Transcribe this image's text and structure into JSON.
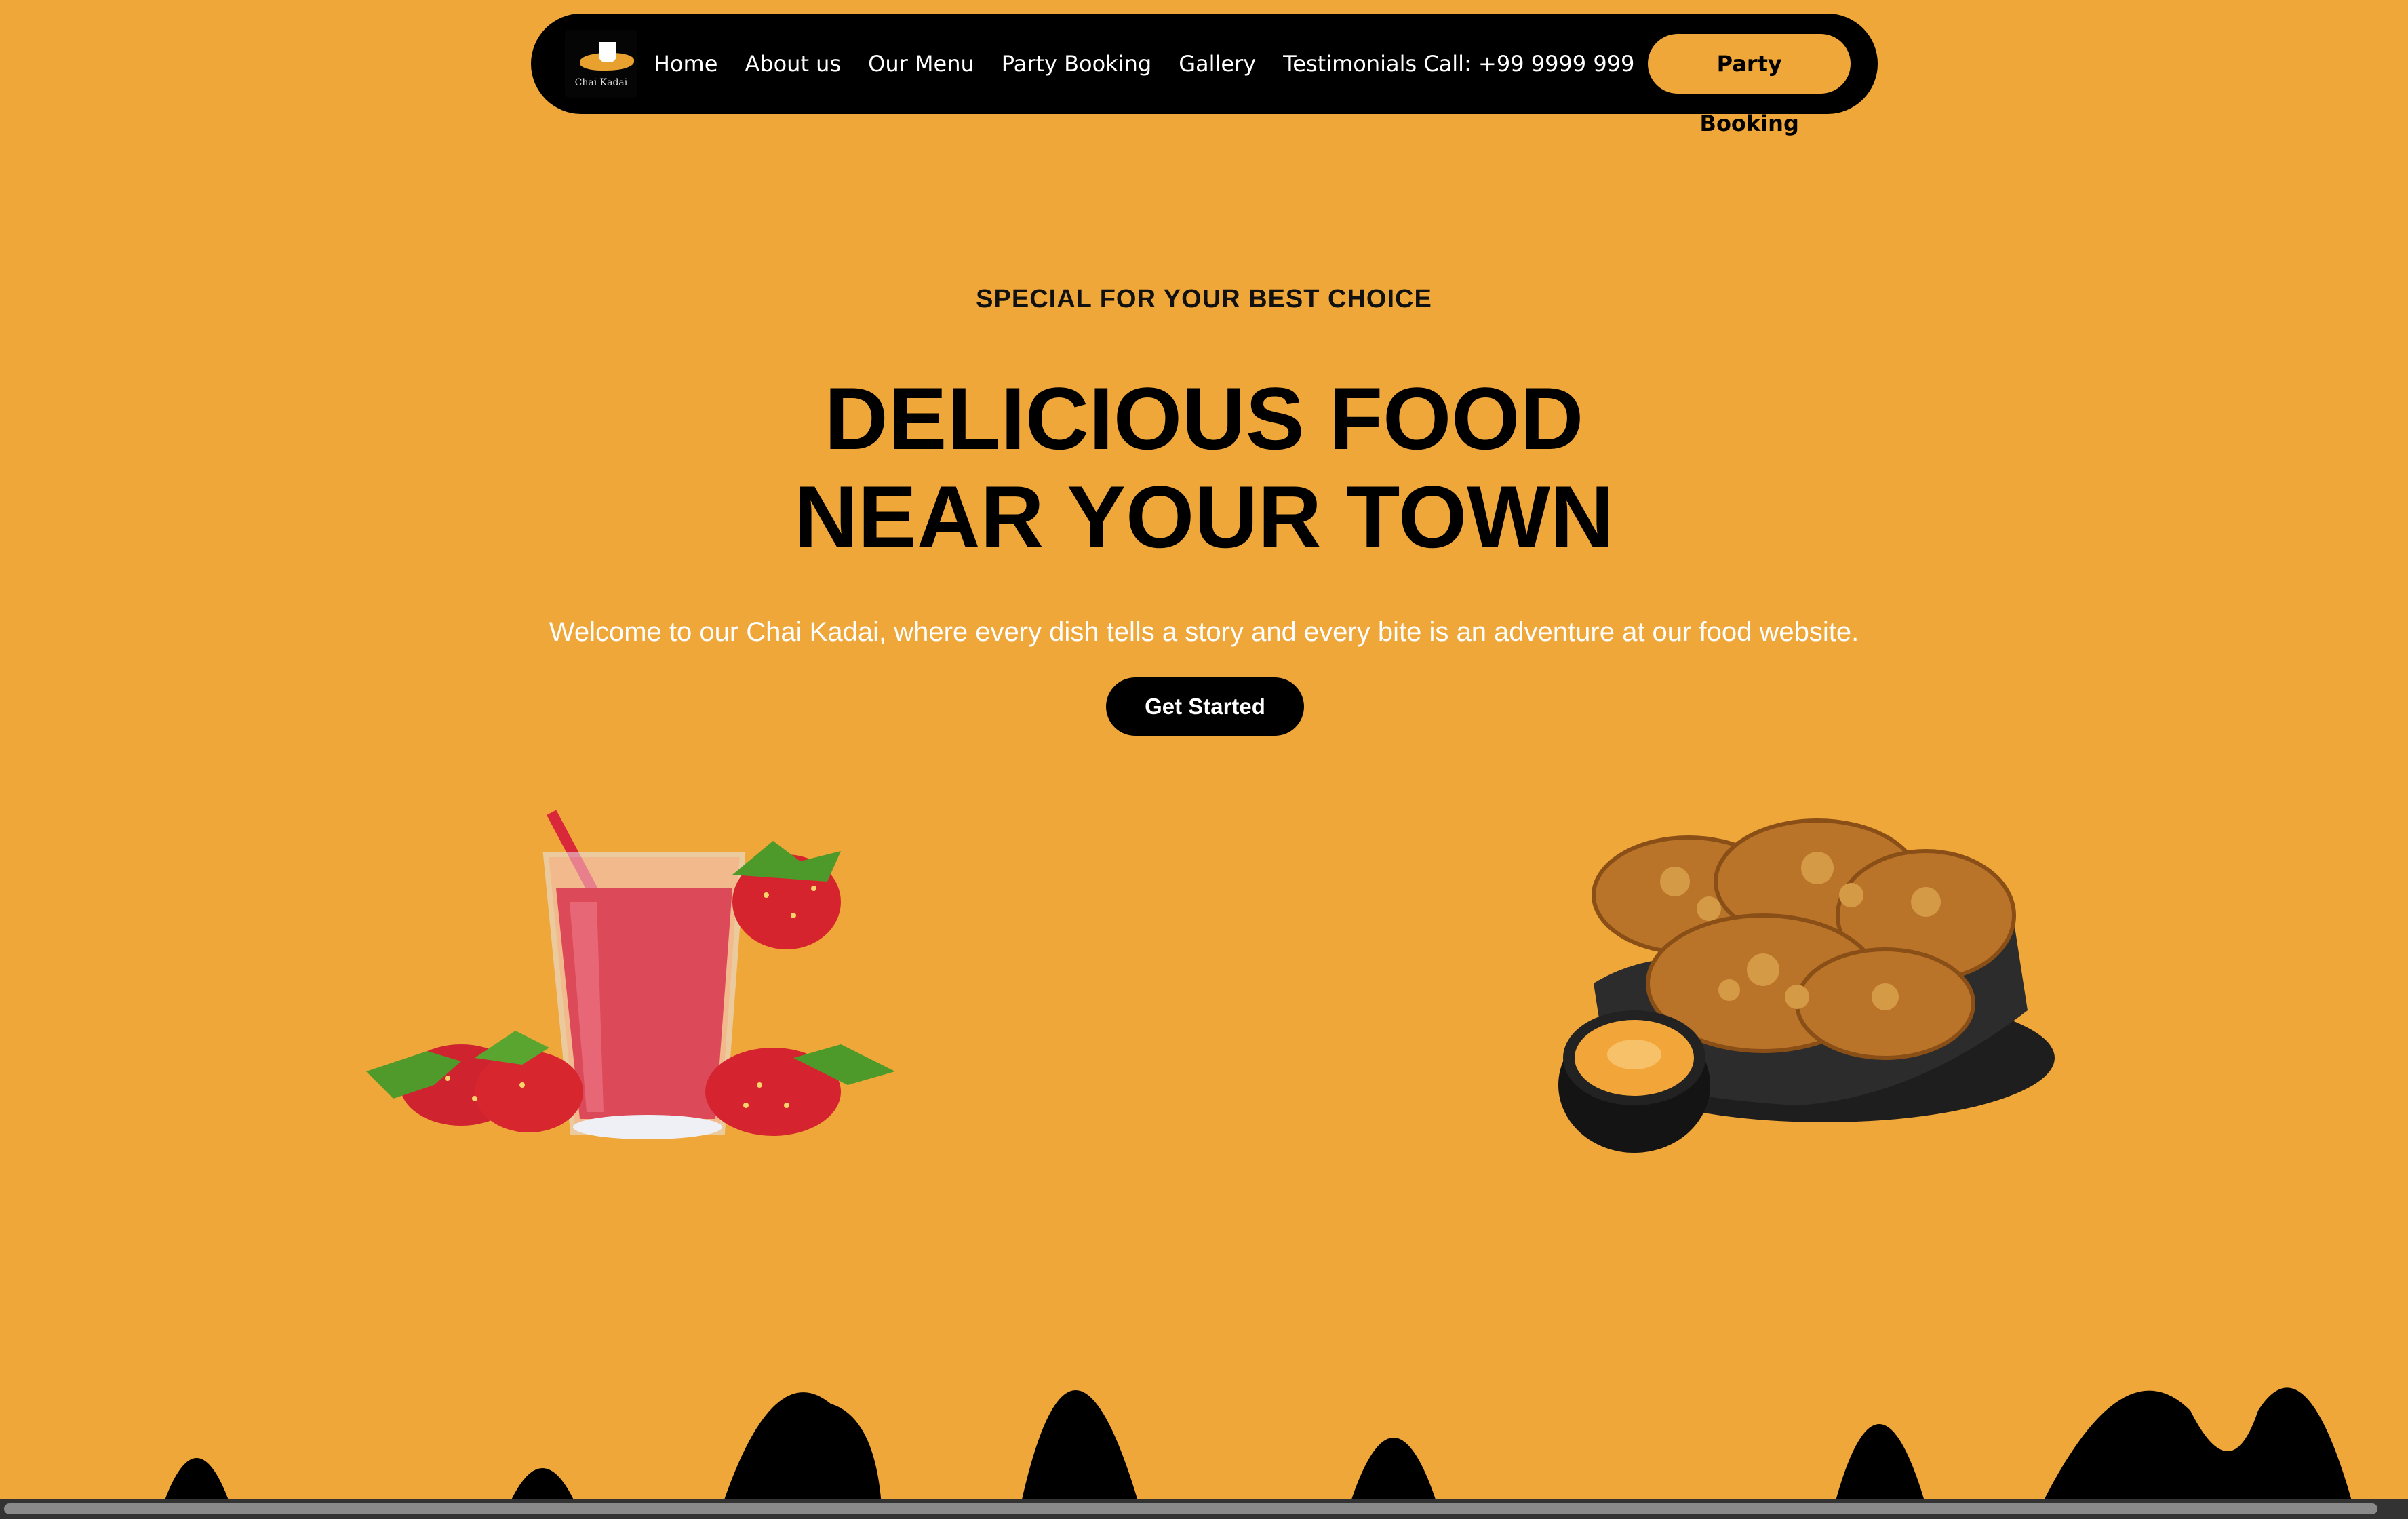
{
  "nav": {
    "logo_text": "Chai Kadai",
    "items": [
      "Home",
      "About us",
      "Our Menu",
      "Party Booking",
      "Gallery",
      "Testimonials Call: +99 9999 999"
    ],
    "cta_label": "Party Booking"
  },
  "hero": {
    "eyebrow": "SPECIAL FOR YOUR BEST CHOICE",
    "headline_line1": "DELICIOUS FOOD",
    "headline_line2": "NEAR YOUR TOWN",
    "lead": "Welcome to our Chai Kadai, where every dish tells a story and every bite is an adventure at our food website.",
    "cta_label": "Get Started"
  },
  "colors": {
    "background": "#EFA73A",
    "nav_background": "#000000",
    "accent": "#EFA73A"
  },
  "images": [
    "strawberry-smoothie",
    "fried-chicken-with-dip"
  ]
}
